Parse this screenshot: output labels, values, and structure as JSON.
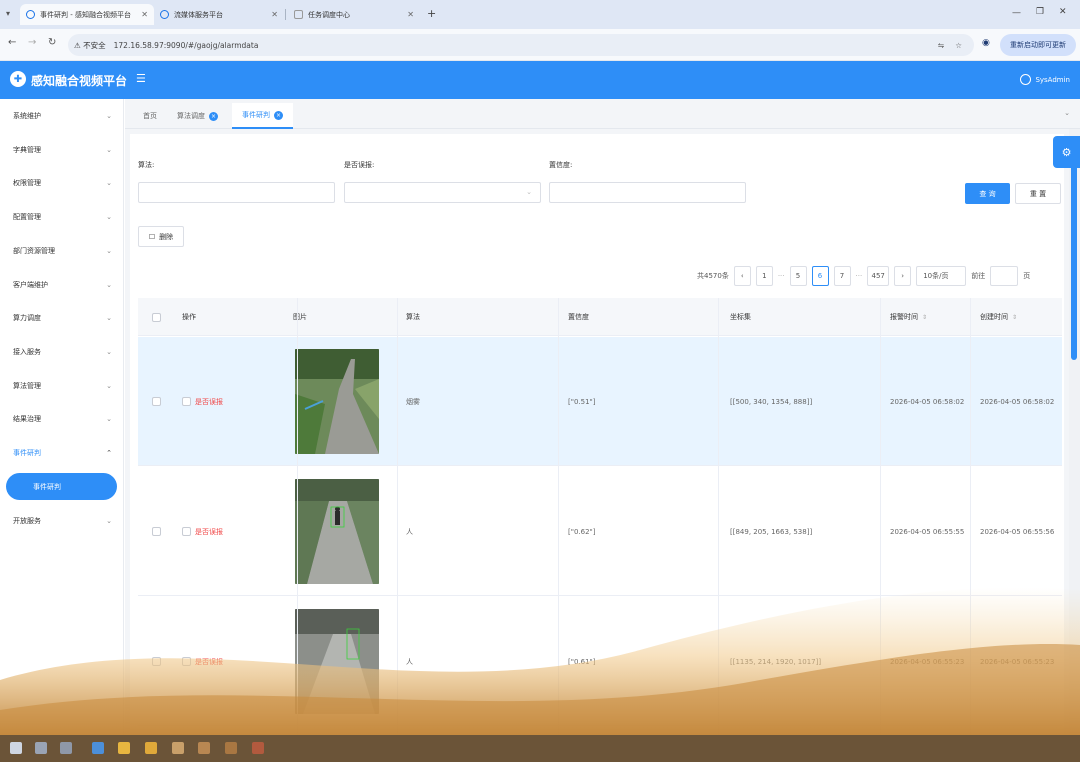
{
  "browser": {
    "tabs": [
      {
        "title": "事件研判 - 感知融合视频平台",
        "active": true
      },
      {
        "title": "流媒体服务平台",
        "active": false
      },
      {
        "title": "任务调度中心",
        "active": false
      }
    ],
    "new_tab": "+",
    "omnibox": {
      "security": "不安全",
      "url": "172.16.58.97:9090/#/gaojg/alarmdata"
    },
    "update_button": "重新启动即可更新"
  },
  "app": {
    "title": "感知融合视频平台",
    "user": "SysAdmin"
  },
  "sidebar": {
    "items": [
      {
        "label": "系统维护",
        "expanded": false
      },
      {
        "label": "字典管理",
        "expanded": false
      },
      {
        "label": "权限管理",
        "expanded": false
      },
      {
        "label": "配置管理",
        "expanded": false
      },
      {
        "label": "部门资源管理",
        "expanded": false
      },
      {
        "label": "客户端维护",
        "expanded": false
      },
      {
        "label": "算力调度",
        "expanded": false
      },
      {
        "label": "接入服务",
        "expanded": false
      },
      {
        "label": "算法管理",
        "expanded": false
      },
      {
        "label": "结果治理",
        "expanded": false
      },
      {
        "label": "事件研判",
        "expanded": true
      },
      {
        "label": "开放服务",
        "expanded": false
      }
    ],
    "active_sub": "事件研判"
  },
  "content_tabs": [
    {
      "label": "首页",
      "badge": false
    },
    {
      "label": "算法调度",
      "badge": true
    },
    {
      "label": "事件研判",
      "badge": true
    }
  ],
  "filters": {
    "algo_label": "算法:",
    "confirm_label": "是否误报:",
    "confidence_label": "置信度:",
    "algo_value": "",
    "confirm_value": "",
    "confidence_value": "",
    "search_btn": "查 询",
    "reset_btn": "重 置",
    "delete_btn": "删除"
  },
  "pagination": {
    "total": "共4570条",
    "pages": [
      "1",
      "5",
      "6",
      "7",
      "457"
    ],
    "current": "6",
    "page_size": "10条/页",
    "goto_label": "前往",
    "goto_suffix": "页",
    "prev": "‹",
    "next": "›",
    "ellipsis": "···"
  },
  "table": {
    "headers": [
      "操作",
      "图片",
      "算法",
      "置信度",
      "坐标集",
      "报警时间",
      "创建时间"
    ],
    "rows": [
      {
        "action": "是否误报",
        "algo": "烟雾",
        "confidence": "[\"0.51\"]",
        "coords": "[[500, 340, 1354, 888]]",
        "alarm_time": "2026-04-05 06:58:02",
        "create_time": "2026-04-05 06:58:02",
        "highlight": true
      },
      {
        "action": "是否误报",
        "algo": "人",
        "confidence": "[\"0.62\"]",
        "coords": "[[849, 205, 1663, 538]]",
        "alarm_time": "2026-04-05 06:55:55",
        "create_time": "2026-04-05 06:55:56",
        "highlight": false
      },
      {
        "action": "是否误报",
        "algo": "人",
        "confidence": "[\"0.61\"]",
        "coords": "[[1135, 214, 1920, 1017]]",
        "alarm_time": "2026-04-05 06:55:23",
        "create_time": "2026-04-05 06:55:23",
        "highlight": false
      }
    ]
  },
  "colors": {
    "primary": "#2e8ef7",
    "danger": "#f04848",
    "highlight_row": "#e8f4ff"
  }
}
